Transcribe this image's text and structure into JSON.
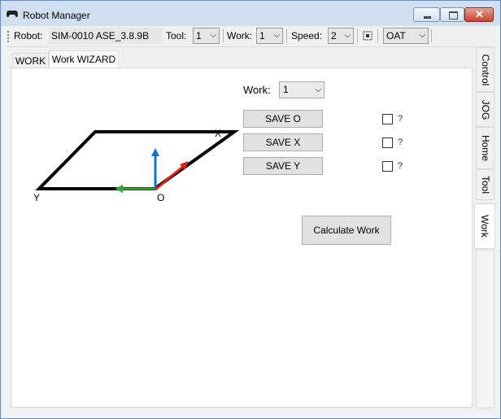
{
  "window": {
    "title": "Robot Manager"
  },
  "toolbar": {
    "robot_label": "Robot:",
    "robot_value": "SIM-0010 ASE_3.8.9B",
    "tool_label": "Tool:",
    "tool_value": "1",
    "work_label": "Work:",
    "work_value": "1",
    "speed_label": "Speed:",
    "speed_value": "2",
    "frame_value": "OAT"
  },
  "tabs": [
    {
      "label": "WORK",
      "active": false
    },
    {
      "label": "Work WIZARD",
      "active": true
    }
  ],
  "side_tabs": [
    {
      "label": "Control",
      "active": false
    },
    {
      "label": "JOG",
      "active": false
    },
    {
      "label": "Home",
      "active": false
    },
    {
      "label": "Tool",
      "active": false
    },
    {
      "label": "Work",
      "active": true
    }
  ],
  "wizard": {
    "work_label": "Work:",
    "work_value": "1",
    "save_o": "SAVE O",
    "save_x": "SAVE X",
    "save_y": "SAVE Y",
    "check_o_label": "?",
    "check_x_label": "?",
    "check_y_label": "?",
    "check_o_checked": false,
    "check_x_checked": false,
    "check_y_checked": false,
    "calculate": "Calculate Work"
  },
  "diagram": {
    "label_x": "X",
    "label_y": "Y",
    "label_o": "O",
    "colors": {
      "frame": "#000000",
      "x_axis": "#e31a1a",
      "y_axis": "#3aa33a",
      "z_axis": "#1670c9"
    }
  }
}
